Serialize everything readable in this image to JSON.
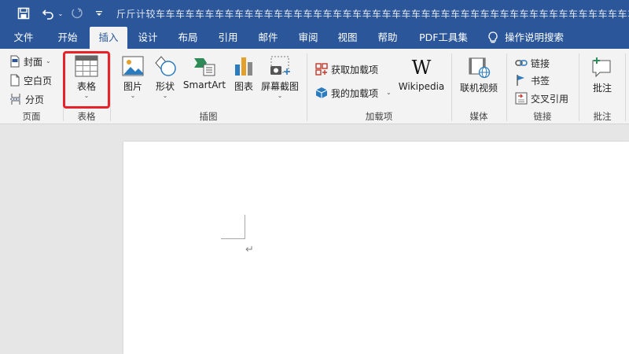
{
  "quick_access": {
    "save_icon": "save-icon",
    "undo_icon": "undo-icon",
    "redo_icon": "redo-icon",
    "customize_icon": "customize-qat-icon",
    "doc_title": "斤斤计较车车车车车车车车车车车车车车车车车车车车车车车车车车车车车车车车车车车车车车车车车车车车车车车车车车车"
  },
  "tabs": [
    {
      "label": "文件",
      "active": false
    },
    {
      "label": "开始",
      "active": false
    },
    {
      "label": "插入",
      "active": true
    },
    {
      "label": "设计",
      "active": false
    },
    {
      "label": "布局",
      "active": false
    },
    {
      "label": "引用",
      "active": false
    },
    {
      "label": "邮件",
      "active": false
    },
    {
      "label": "审阅",
      "active": false
    },
    {
      "label": "视图",
      "active": false
    },
    {
      "label": "帮助",
      "active": false
    },
    {
      "label": "PDF工具集",
      "active": false
    }
  ],
  "tell_me": {
    "label": "操作说明搜索",
    "icon": "lightbulb-icon"
  },
  "ribbon": {
    "pages": {
      "group_label": "页面",
      "cover": "封面",
      "blank": "空白页",
      "break": "分页"
    },
    "tables": {
      "group_label": "表格",
      "table": "表格"
    },
    "illustrations": {
      "group_label": "插图",
      "pictures": "图片",
      "shapes": "形状",
      "smartart": "SmartArt",
      "chart": "图表",
      "screenshot": "屏幕截图"
    },
    "addins": {
      "group_label": "加载项",
      "get": "获取加载项",
      "my": "我的加载项",
      "wikipedia": "Wikipedia",
      "wiki_glyph": "W"
    },
    "media": {
      "group_label": "媒体",
      "video": "联机视频"
    },
    "links": {
      "group_label": "链接",
      "link": "链接",
      "bookmark": "书签",
      "xref": "交叉引用"
    },
    "comments": {
      "group_label": "批注",
      "comment": "批注"
    }
  },
  "document": {
    "paragraph_mark": "↵"
  },
  "colors": {
    "accent": "#2b579a",
    "highlight": "#e8222a"
  }
}
